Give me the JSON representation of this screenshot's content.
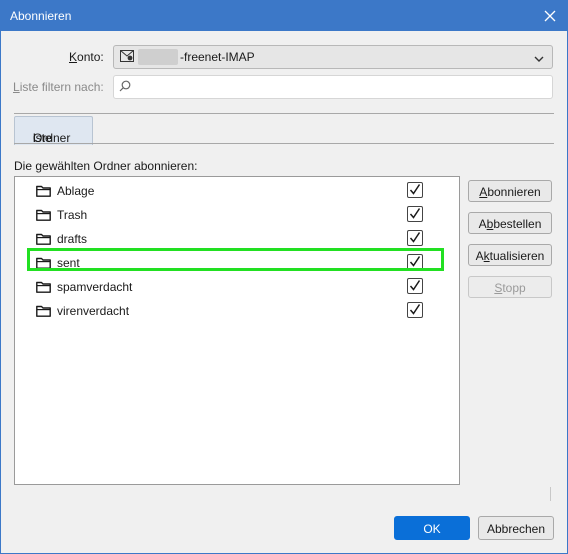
{
  "window": {
    "title": "Abonnieren"
  },
  "form": {
    "account_label": "Konto:",
    "account_value": "-freenet-IMAP",
    "filter_label": "Liste filtern nach:",
    "filter_value": "",
    "filter_placeholder": ""
  },
  "tabs": [
    {
      "label": "Ordnerliste",
      "selected": true
    }
  ],
  "list": {
    "heading": "Die gewählten Ordner abonnieren:",
    "folders": [
      {
        "name": "Ablage",
        "subscribed": true
      },
      {
        "name": "Trash",
        "subscribed": true
      },
      {
        "name": "drafts",
        "subscribed": true
      },
      {
        "name": "sent",
        "subscribed": true,
        "highlighted": true
      },
      {
        "name": "spamverdacht",
        "subscribed": true
      },
      {
        "name": "virenverdacht",
        "subscribed": true
      }
    ]
  },
  "side_buttons": {
    "subscribe": "Abonnieren",
    "unsubscribe": "Abbestellen",
    "refresh": "Aktualisieren",
    "stop": "Stopp"
  },
  "footer": {
    "ok": "OK",
    "cancel": "Abbrechen"
  },
  "colors": {
    "titlebar": "#3c78c8",
    "primary": "#0a6fd8",
    "highlight": "#22e022"
  },
  "icons": [
    "close-icon",
    "account-icon",
    "chevron-down-icon",
    "search-icon",
    "folder-icon",
    "checkmark-icon"
  ]
}
